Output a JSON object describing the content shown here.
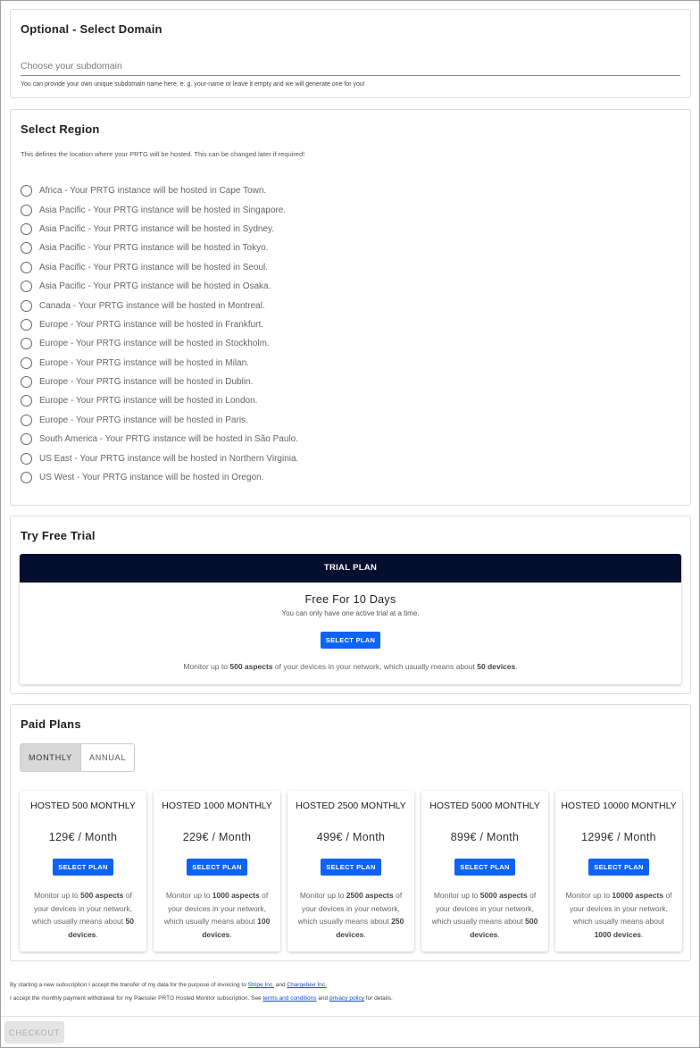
{
  "domain": {
    "title": "Optional - Select Domain",
    "placeholder": "Choose your subdomain",
    "value": "",
    "hint": "You can provide your own unique subdomain name here, e. g. your-name or leave it empty and we will generate one for you!"
  },
  "region": {
    "title": "Select Region",
    "description": "This defines the location where your PRTG will be hosted. This can be changed later if required!",
    "options": [
      "Africa - Your PRTG instance will be hosted in Cape Town.",
      "Asia Pacific - Your PRTG instance will be hosted in Singapore.",
      "Asia Pacific - Your PRTG instance will be hosted in Sydney.",
      "Asia Pacific - Your PRTG instance will be hosted in Tokyo.",
      "Asia Pacific - Your PRTG instance will be hosted in Seoul.",
      "Asia Pacific - Your PRTG instance will be hosted in Osaka.",
      "Canada - Your PRTG instance will be hosted in Montreal.",
      "Europe - Your PRTG instance will be hosted in Frankfurt.",
      "Europe - Your PRTG instance will be hosted in Stockholm.",
      "Europe - Your PRTG instance will be hosted in Milan.",
      "Europe - Your PRTG instance will be hosted in Dublin.",
      "Europe - Your PRTG instance will be hosted in London.",
      "Europe - Your PRTG instance will be hosted in Paris.",
      "South America - Your PRTG instance will be hosted in São Paulo.",
      "US East - Your PRTG instance will be hosted in Northern Virginia.",
      "US West - Your PRTG instance will be hosted in Oregon."
    ]
  },
  "trial": {
    "title": "Try Free Trial",
    "header": "TRIAL PLAN",
    "name": "Free For 10 Days",
    "note": "You can only have one active trial at a time.",
    "button": "SELECT PLAN",
    "desc_pre": "Monitor up to ",
    "desc_aspects": "500 aspects",
    "desc_mid": " of your devices in your network, which usually means about ",
    "desc_devices": "50 devices",
    "desc_post": "."
  },
  "paid": {
    "title": "Paid Plans",
    "toggle_monthly": "MONTHLY",
    "toggle_annual": "ANNUAL",
    "button": "SELECT PLAN",
    "plans": [
      {
        "name": "HOSTED 500 MONTHLY",
        "price": "129€ / Month",
        "aspects": "500 aspects",
        "devices": "50 devices"
      },
      {
        "name": "HOSTED 1000 MONTHLY",
        "price": "229€ / Month",
        "aspects": "1000 aspects",
        "devices": "100 devices"
      },
      {
        "name": "HOSTED 2500 MONTHLY",
        "price": "499€ / Month",
        "aspects": "2500 aspects",
        "devices": "250 devices"
      },
      {
        "name": "HOSTED 5000 MONTHLY",
        "price": "899€ / Month",
        "aspects": "5000 aspects",
        "devices": "500 devices"
      },
      {
        "name": "HOSTED 10000 MONTHLY",
        "price": "1299€ / Month",
        "aspects": "10000 aspects",
        "devices": "1000 devices"
      }
    ],
    "desc_pre": "Monitor up to ",
    "desc_mid": " of your devices in your network, which usually means about ",
    "desc_post": "."
  },
  "legal": {
    "line1_pre": "By starting a new subscription I accept the transfer of my data for the purpose of invoicing to ",
    "link_stripe": "Stripe Inc.",
    "line1_and": " and ",
    "link_chargebee": "Chargebee Inc.",
    "line2_pre": "I accept the monthly payment withdrawal for my Paessler PRTG Hosted Monitor subscription. See ",
    "link_terms": "terms and conditions",
    "line2_and": " and ",
    "link_privacy": "privacy policy",
    "line2_post": " for details."
  },
  "checkout": "CHECKOUT"
}
